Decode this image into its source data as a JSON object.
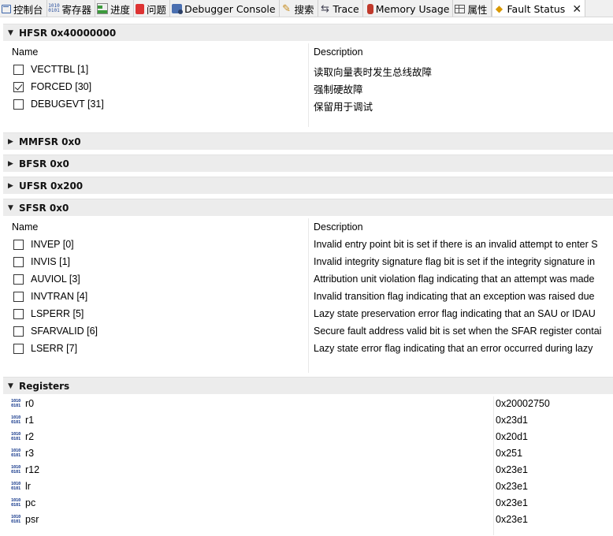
{
  "tabs": [
    {
      "label": "控制台",
      "icon": "console-icon"
    },
    {
      "label": "寄存器",
      "icon": "registers-icon"
    },
    {
      "label": "进度",
      "icon": "progress-icon"
    },
    {
      "label": "问题",
      "icon": "problems-icon"
    },
    {
      "label": "Debugger Console",
      "icon": "debugger-console-icon"
    },
    {
      "label": "搜索",
      "icon": "search-icon"
    },
    {
      "label": "Trace",
      "icon": "trace-icon"
    },
    {
      "label": "Memory Usage",
      "icon": "memory-usage-icon"
    },
    {
      "label": "属性",
      "icon": "properties-icon"
    },
    {
      "label": "Fault Status",
      "icon": "fault-status-icon",
      "active": true
    }
  ],
  "columns": {
    "name": "Name",
    "description": "Description"
  },
  "hfsr": {
    "title": "HFSR 0x40000000",
    "bits": [
      {
        "name": "VECTTBL [1]",
        "checked": false,
        "description": "读取向量表时发生总线故障"
      },
      {
        "name": "FORCED [30]",
        "checked": true,
        "description": "强制硬故障"
      },
      {
        "name": "DEBUGEVT [31]",
        "checked": false,
        "description": "保留用于调试"
      }
    ]
  },
  "mmfsr": {
    "title": "MMFSR 0x0"
  },
  "bfsr": {
    "title": "BFSR 0x0"
  },
  "ufsr": {
    "title": "UFSR 0x200"
  },
  "sfsr": {
    "title": "SFSR 0x0",
    "bits": [
      {
        "name": "INVEP [0]",
        "checked": false,
        "description": "Invalid entry point bit is set if there is an invalid attempt to enter S"
      },
      {
        "name": "INVIS [1]",
        "checked": false,
        "description": "Invalid integrity signature flag bit is set if the integrity signature in"
      },
      {
        "name": "AUVIOL [3]",
        "checked": false,
        "description": "Attribution unit violation flag indicating that an attempt was made"
      },
      {
        "name": "INVTRAN [4]",
        "checked": false,
        "description": "Invalid transition flag indicating that an exception was raised due"
      },
      {
        "name": "LSPERR [5]",
        "checked": false,
        "description": "Lazy state preservation error flag indicating that an SAU or IDAU"
      },
      {
        "name": "SFARVALID [6]",
        "checked": false,
        "description": "Secure fault address valid bit is set when the SFAR register contai"
      },
      {
        "name": "LSERR [7]",
        "checked": false,
        "description": "Lazy state error flag indicating that an error occurred during lazy"
      }
    ]
  },
  "registers": {
    "title": "Registers",
    "icon_glyph": [
      "1010",
      "0101"
    ],
    "items": [
      {
        "name": "r0",
        "value": "0x20002750"
      },
      {
        "name": "r1",
        "value": "0x23d1"
      },
      {
        "name": "r2",
        "value": "0x20d1"
      },
      {
        "name": "r3",
        "value": "0x251"
      },
      {
        "name": "r12",
        "value": "0x23e1"
      },
      {
        "name": "lr",
        "value": "0x23e1"
      },
      {
        "name": "pc",
        "value": "0x23e1"
      },
      {
        "name": "psr",
        "value": "0x23e1"
      }
    ]
  }
}
